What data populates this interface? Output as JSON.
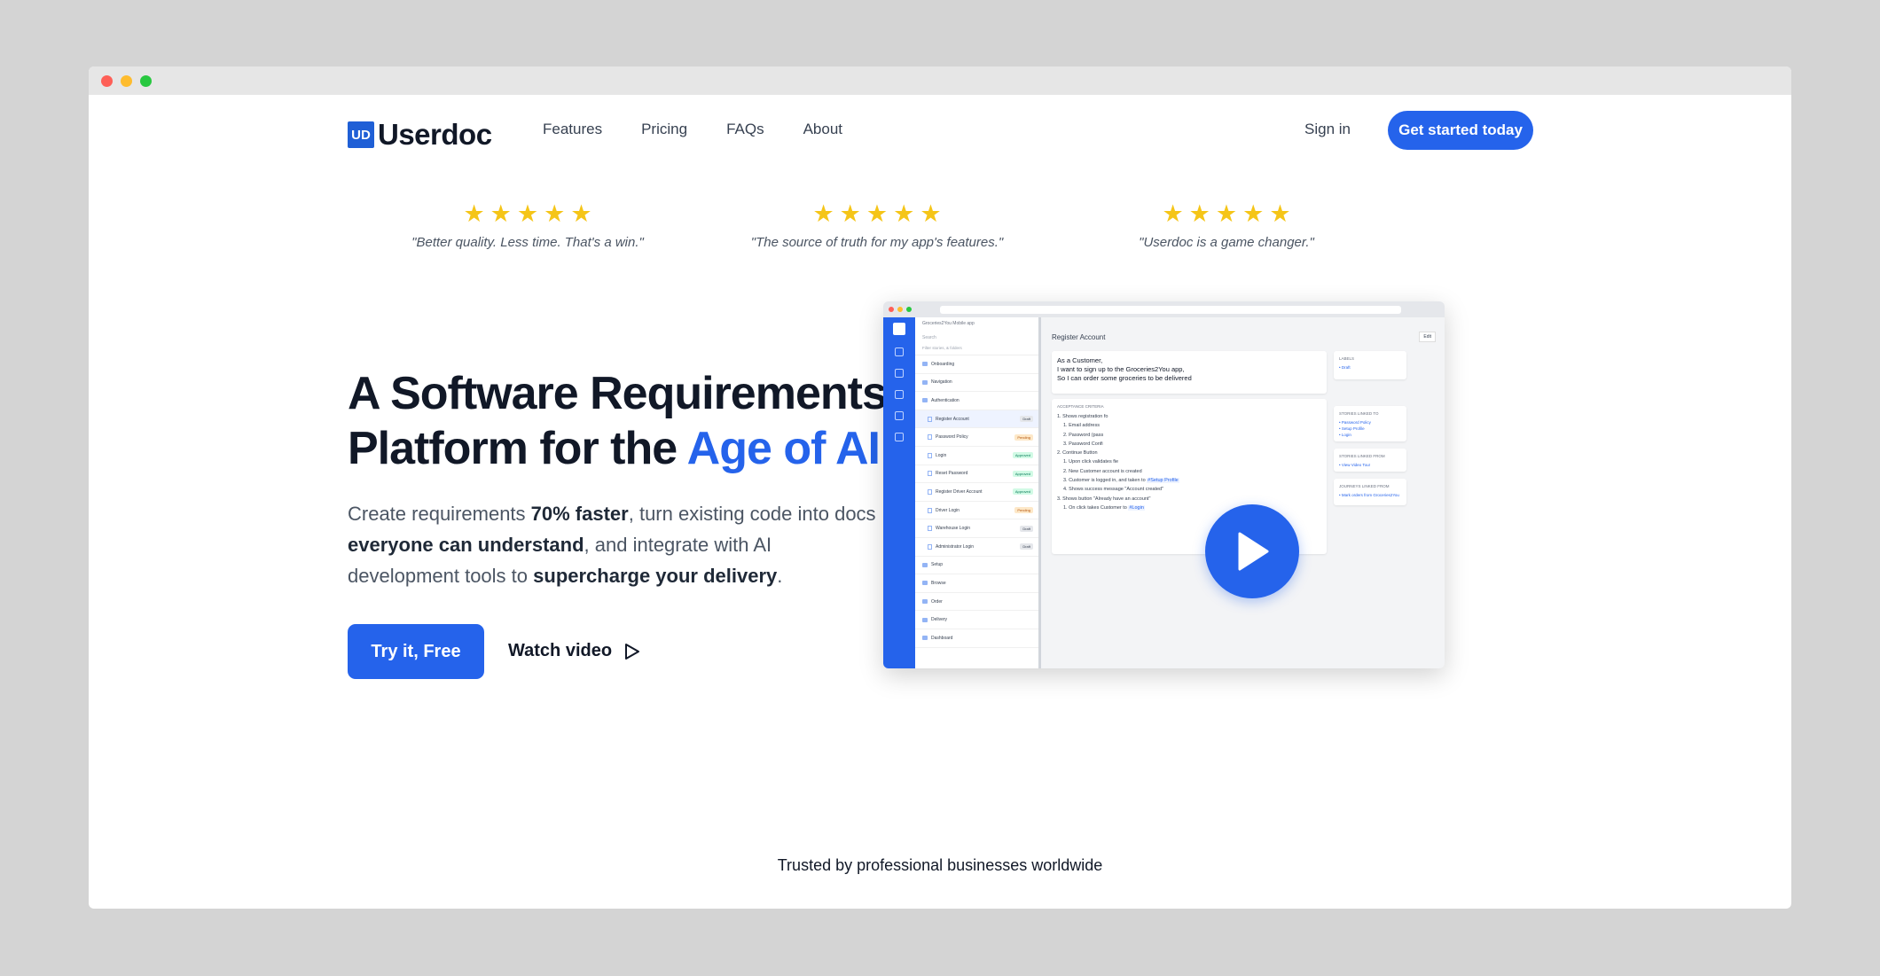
{
  "nav": {
    "logo_mark": "UD",
    "logo_text": "Userdoc",
    "links": [
      "Features",
      "Pricing",
      "FAQs",
      "About"
    ],
    "sign_in": "Sign in",
    "cta": "Get started today"
  },
  "reviews": [
    {
      "stars": 5,
      "quote": "\"Better quality. Less time. That's a win.\""
    },
    {
      "stars": 5,
      "quote": "\"The source of truth for my app's features.\""
    },
    {
      "stars": 5,
      "quote": "\"Userdoc is a game changer.\""
    }
  ],
  "hero": {
    "headline_part1": "A Software Requirements Platform for the ",
    "headline_accent": "Age of AI",
    "sub": {
      "t1": "Create requirements ",
      "b1": "70% faster",
      "t2": ", turn existing code into docs ",
      "b2": "everyone can understand",
      "t3": ", and integrate with AI development tools to ",
      "b3": "supercharge your delivery",
      "t4": "."
    },
    "primary_button": "Try it, Free",
    "secondary_button": "Watch video"
  },
  "preview": {
    "project": "Groceries2You Mobile app",
    "search": "Search",
    "filter": "Filter stories, & folders",
    "tree": [
      {
        "type": "folder",
        "label": "Onboarding"
      },
      {
        "type": "folder",
        "label": "Navigation"
      },
      {
        "type": "folder",
        "label": "Authentication"
      },
      {
        "type": "page",
        "label": "Register Account",
        "status": "Draft",
        "status_class": "draft",
        "active": true
      },
      {
        "type": "page",
        "label": "Password Policy",
        "status": "Pending",
        "status_class": "pending"
      },
      {
        "type": "page",
        "label": "Login",
        "status": "Approved",
        "status_class": "approved"
      },
      {
        "type": "page",
        "label": "Reset Password",
        "status": "Approved",
        "status_class": "approved"
      },
      {
        "type": "page",
        "label": "Register Driver Account",
        "status": "Approved",
        "status_class": "approved"
      },
      {
        "type": "page",
        "label": "Driver Login",
        "status": "Pending",
        "status_class": "pending"
      },
      {
        "type": "page",
        "label": "Warehouse Login",
        "status": "Draft",
        "status_class": "draft"
      },
      {
        "type": "page",
        "label": "Administrator Login",
        "status": "Draft",
        "status_class": "draft"
      },
      {
        "type": "folder",
        "label": "Setup"
      },
      {
        "type": "folder",
        "label": "Browse"
      },
      {
        "type": "folder",
        "label": "Order"
      },
      {
        "type": "folder",
        "label": "Delivery"
      },
      {
        "type": "folder",
        "label": "Dashboard"
      }
    ],
    "story_title": "Register Account",
    "edit": "Edit",
    "story_text": [
      "As a Customer,",
      "I want to sign up to the Groceries2You app,",
      "So I can order some groceries to be delivered"
    ],
    "criteria_heading": "ACCEPTANCE CRITERIA",
    "criteria": [
      "1. Shows registration fo",
      "1. Email address",
      "2. Password (pass",
      "3. Password Confi",
      "2. Continue Button",
      "1. Upon click validates fie",
      "2. New Customer account is created",
      "3. Customer is logged in, and taken to #Setup Profile",
      "4. Shows success message \"Account created\"",
      "3. Shows button \"Already have an account\"",
      "1. On click takes Customer to #Login"
    ],
    "side_cards": [
      {
        "title": "LABELS",
        "links": [
          "Draft"
        ]
      },
      {
        "title": "STORIES LINKED TO",
        "links": [
          "Password Policy",
          "Setup Profile",
          "Login"
        ]
      },
      {
        "title": "STORIES LINKED FROM",
        "links": [
          "View Video Tour"
        ]
      },
      {
        "title": "JOURNEYS LINKED FROM",
        "links": [
          "Mark orders from Groceries2You"
        ]
      }
    ]
  },
  "trusted": "Trusted by professional businesses worldwide",
  "colors": {
    "accent": "#2563eb",
    "star": "#f5c518"
  }
}
